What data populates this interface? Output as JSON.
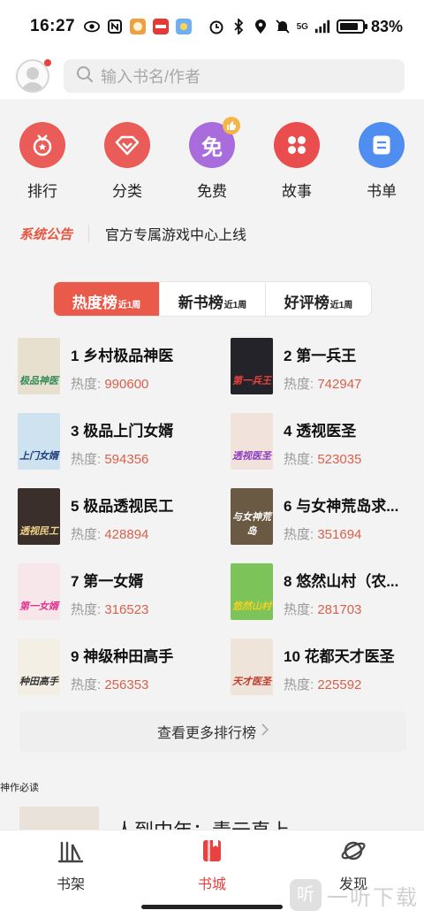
{
  "status_bar": {
    "time": "16:27",
    "network": "5G",
    "battery_pct": "83%",
    "battery_level": 0.83
  },
  "header": {
    "search_placeholder": "输入书名/作者"
  },
  "categories": [
    {
      "label": "排行",
      "icon": "medal-icon",
      "color": "#ea5c57"
    },
    {
      "label": "分类",
      "icon": "diamond-icon",
      "color": "#ea5c57"
    },
    {
      "label": "免费",
      "icon": "free-icon",
      "color": "#a86cdc",
      "badge_icon": "thumbs-up-icon",
      "icon_text": "免"
    },
    {
      "label": "故事",
      "icon": "grid-icon",
      "color": "#ea4d4e"
    },
    {
      "label": "书单",
      "icon": "list-icon",
      "color": "#4f8ef0"
    }
  ],
  "notice": {
    "tag": "系统公告",
    "text": "官方专属游戏中心上线"
  },
  "tabs": [
    {
      "label": "热度榜",
      "sub": "近1周",
      "active": true
    },
    {
      "label": "新书榜",
      "sub": "近1周",
      "active": false
    },
    {
      "label": "好评榜",
      "sub": "近1周",
      "active": false
    }
  ],
  "ranking": {
    "heat_label": "热度: ",
    "items": [
      {
        "rank": "1",
        "title": "乡村极品神医",
        "heat": "990600",
        "cover_text": "极品神医",
        "cover_color": "#e8e0cf",
        "cover_text_color": "#2e8b57"
      },
      {
        "rank": "2",
        "title": "第一兵王",
        "heat": "742947",
        "cover_text": "第一兵王",
        "cover_color": "#232329",
        "cover_text_color": "#e8413f"
      },
      {
        "rank": "3",
        "title": "极品上门女婿",
        "heat": "594356",
        "cover_text": "上门女婿",
        "cover_color": "#cfe2ef",
        "cover_text_color": "#1f3f7a"
      },
      {
        "rank": "4",
        "title": "透视医圣",
        "heat": "523035",
        "cover_text": "透视医圣",
        "cover_color": "#f1e3dc",
        "cover_text_color": "#8a3bbf"
      },
      {
        "rank": "5",
        "title": "极品透视民工",
        "heat": "428894",
        "cover_text": "透视民工",
        "cover_color": "#3a2f2a",
        "cover_text_color": "#f0d28a"
      },
      {
        "rank": "6",
        "title": "与女神荒岛求...",
        "heat": "351694",
        "cover_text": "与女神荒岛",
        "cover_color": "#6b5a43",
        "cover_text_color": "#ffffff"
      },
      {
        "rank": "7",
        "title": "第一女婿",
        "heat": "316523",
        "cover_text": "第一女婿",
        "cover_color": "#f7e6ea",
        "cover_text_color": "#e0338c"
      },
      {
        "rank": "8",
        "title": "悠然山村（农...",
        "heat": "281703",
        "cover_text": "悠然山村",
        "cover_color": "#7cc35a",
        "cover_text_color": "#f5d020"
      },
      {
        "rank": "9",
        "title": "神级种田高手",
        "heat": "256353",
        "cover_text": "种田高手",
        "cover_color": "#f4efe4",
        "cover_text_color": "#333333"
      },
      {
        "rank": "10",
        "title": "花都天才医圣",
        "heat": "225592",
        "cover_text": "天才医圣",
        "cover_color": "#efe4da",
        "cover_text_color": "#c0392b"
      }
    ]
  },
  "more_button": {
    "label": "查看更多排行榜"
  },
  "section": {
    "title": "神作必读",
    "partial_book_title": "人到中年：青云直上"
  },
  "bottom_nav": [
    {
      "label": "书架",
      "icon": "bookshelf-icon",
      "active": false
    },
    {
      "label": "书城",
      "icon": "bookstore-icon",
      "active": true
    },
    {
      "label": "发现",
      "icon": "planet-icon",
      "active": false
    }
  ],
  "watermark": {
    "logo_text": "听",
    "text": "一听下载"
  },
  "colors": {
    "accent": "#e8413f",
    "tab_active": "#e95a4b",
    "heat_value": "#d9604c"
  }
}
